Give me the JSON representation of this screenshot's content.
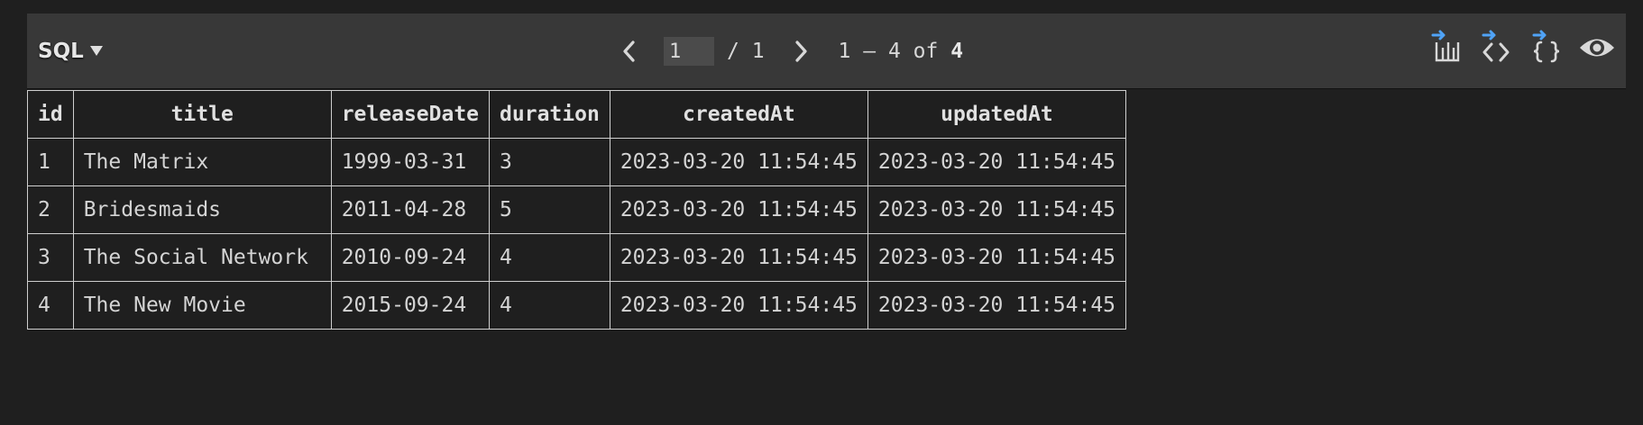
{
  "toolbar": {
    "language_label": "SQL",
    "language_icon": "caret-down-icon",
    "pagination": {
      "current_page": "1",
      "total_pages_text": "/ 1",
      "range_start": "1",
      "range_end": "4",
      "range_sep": " – ",
      "of_word": " of ",
      "total_rows": "4"
    },
    "actions": [
      {
        "name": "export-csv-button",
        "icon": "export-table-icon"
      },
      {
        "name": "export-html-button",
        "icon": "export-code-icon"
      },
      {
        "name": "export-json-button",
        "icon": "export-json-icon"
      },
      {
        "name": "preview-button",
        "icon": "eye-icon"
      }
    ],
    "accent_color": "#4fa3f7"
  },
  "table": {
    "columns": [
      "id",
      "title",
      "releaseDate",
      "duration",
      "createdAt",
      "updatedAt"
    ],
    "rows": [
      [
        "1",
        "The Matrix",
        "1999-03-31",
        "3",
        "2023-03-20 11:54:45",
        "2023-03-20 11:54:45"
      ],
      [
        "2",
        "Bridesmaids",
        "2011-04-28",
        "5",
        "2023-03-20 11:54:45",
        "2023-03-20 11:54:45"
      ],
      [
        "3",
        "The Social Network",
        "2010-09-24",
        "4",
        "2023-03-20 11:54:45",
        "2023-03-20 11:54:45"
      ],
      [
        "4",
        "The New Movie",
        "2015-09-24",
        "4",
        "2023-03-20 11:54:45",
        "2023-03-20 11:54:45"
      ]
    ]
  }
}
